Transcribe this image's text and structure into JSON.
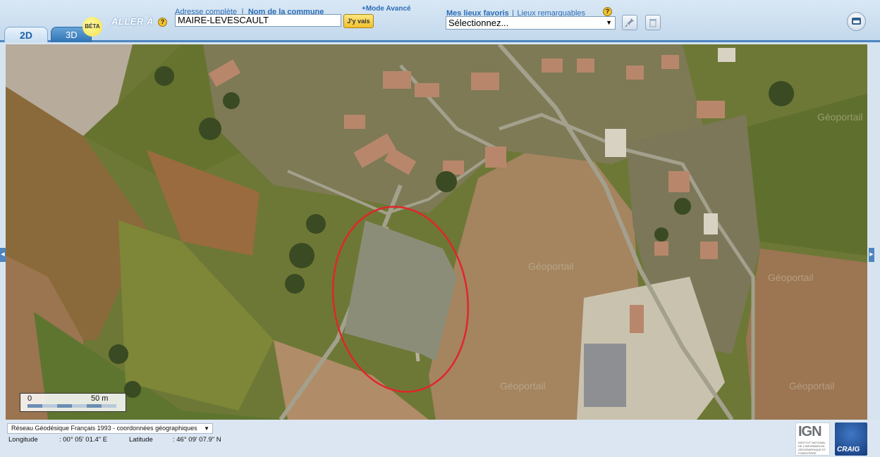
{
  "tabs": [
    {
      "label": "2D",
      "active": true
    },
    {
      "label": "3D",
      "active": false
    }
  ],
  "beta_badge": "BÉTA",
  "goto_label": "ALLER À",
  "help_glyph": "?",
  "address": {
    "full_address_link": "Adresse complète",
    "separator": "|",
    "commune_link": "Nom de la commune",
    "advanced_mode_link": "+Mode Avancé",
    "input_value": "MAIRE-LEVESCAULT",
    "go_button": "J'y vais"
  },
  "favorites": {
    "my_places_link": "Mes lieux favoris",
    "separator": "|",
    "remarkable_link": "Lieux remarquables",
    "select_value": "Sélectionnez..."
  },
  "toolbar_icons": [
    "pin-icon",
    "trash-icon",
    "window-icon"
  ],
  "map": {
    "watermark": "Géoportail",
    "scale": {
      "start": "0",
      "end": "50 m"
    },
    "highlight_color": "#e0262b"
  },
  "footer": {
    "crs_select": "Réseau Géodésique Français 1993 - coordonnées géographiques",
    "longitude_label": "Longitude",
    "longitude_value": ": 00° 05' 01.4\" E",
    "latitude_label": "Latitude",
    "latitude_value": ": 46° 09' 07.9\" N"
  },
  "logos": {
    "ign": "IGN",
    "ign_subtitle": "INSTITUT NATIONAL DE L'INFORMATION GÉOGRAPHIQUE ET FORESTIÈRE",
    "craig": "CRAIG"
  }
}
